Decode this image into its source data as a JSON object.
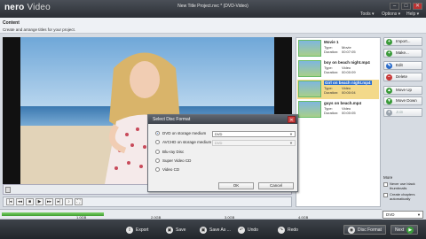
{
  "app": {
    "logo_brand": "nero",
    "logo_product": "Video",
    "window_title": "New Title Project.nvc * (DVD-Video)",
    "window_buttons": [
      "–",
      "□",
      "✕"
    ],
    "menus": [
      "Tools ▾",
      "Options ▾",
      "Help ▾"
    ]
  },
  "content": {
    "title": "Content",
    "subtitle": "Create and arrange titles for your project."
  },
  "titles": [
    {
      "name": "Movie 1",
      "type_label": "Type:",
      "type": "Movie",
      "duration_label": "Duration:",
      "duration": "00:07:05",
      "selected": false
    },
    {
      "name": "boy on beach night.mp4",
      "type_label": "Type:",
      "type": "Video",
      "duration_label": "Duration:",
      "duration": "00:00:09",
      "selected": false
    },
    {
      "name": "Girl on beach night.mp4",
      "type_label": "Type:",
      "type": "Video",
      "duration_label": "Duration:",
      "duration": "00:00:04",
      "selected": true
    },
    {
      "name": "guys on beach.mp4",
      "type_label": "Type:",
      "type": "Video",
      "duration_label": "Duration:",
      "duration": "00:00:05",
      "selected": false
    }
  ],
  "side_buttons": [
    {
      "label": "Import...",
      "icon": "import-icon",
      "color": "#3a9a3a",
      "glyph": "+",
      "enabled": true
    },
    {
      "label": "Make...",
      "icon": "make-icon",
      "color": "#3a9a3a",
      "glyph": "+",
      "enabled": true
    },
    {
      "label": "Edit",
      "icon": "edit-icon",
      "color": "#2a6bc9",
      "glyph": "✎",
      "enabled": true
    },
    {
      "label": "Delete",
      "icon": "delete-icon",
      "color": "#c83a3a",
      "glyph": "−",
      "enabled": true
    },
    {
      "label": "Move Up",
      "icon": "move-up-icon",
      "color": "#3a9a3a",
      "glyph": "▲",
      "enabled": true
    },
    {
      "label": "Move Down",
      "icon": "move-down-icon",
      "color": "#3a9a3a",
      "glyph": "▼",
      "enabled": true
    },
    {
      "label": "Join",
      "icon": "join-icon",
      "color": "#9aa3ad",
      "glyph": "+",
      "enabled": false
    }
  ],
  "more": {
    "label": "More",
    "options": [
      "Never use black thumbnails",
      "Create chapters automatically"
    ]
  },
  "capacity": {
    "used_fraction": 0.27,
    "marks": [
      "1.0GB",
      "2.0GB",
      "3.0GB",
      "4.0GB"
    ],
    "disc": "DVD"
  },
  "bottom_bar": {
    "export": "Export",
    "save": "Save",
    "save_as": "Save As ...",
    "undo": "Undo",
    "redo": "Redo",
    "disc_format": "Disc Format",
    "next": "Next"
  },
  "dialog": {
    "title": "Select Disc Format",
    "options": [
      {
        "label": "DVD on storage medium",
        "checked": true,
        "enabled": true,
        "select": "DVD",
        "select_enabled": true
      },
      {
        "label": "AVCHD on storage medium",
        "checked": false,
        "enabled": true,
        "select": "DVD",
        "select_enabled": false
      },
      {
        "label": "Blu-ray Disc",
        "checked": false,
        "enabled": true
      },
      {
        "label": "Super Video CD",
        "checked": false,
        "enabled": true
      },
      {
        "label": "Video CD",
        "checked": false,
        "enabled": true
      }
    ],
    "ok": "OK",
    "cancel": "Cancel"
  },
  "colors": {
    "accent_selected": "#f3d98a",
    "highlight": "#2b6fd1",
    "capacity_fill": "#3e9e2e"
  }
}
